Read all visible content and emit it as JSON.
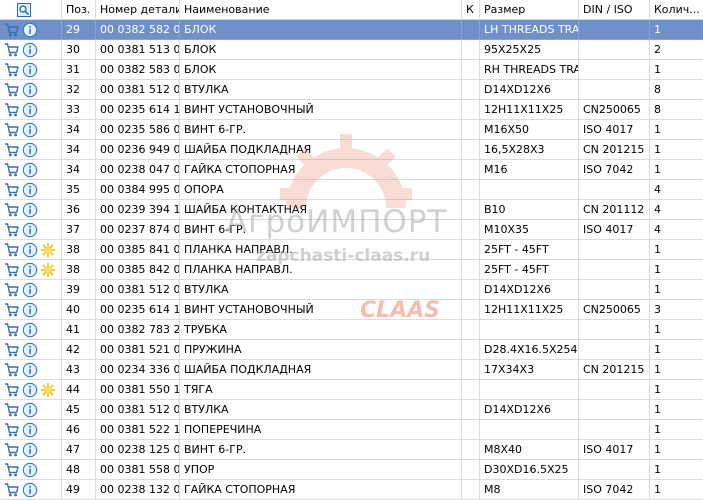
{
  "header": {
    "pos": "Поз.",
    "part_number": "Номер детали",
    "name": "Наименование",
    "k": "К",
    "size": "Размер",
    "din_iso": "DIN / ISO",
    "qty": "Колич..."
  },
  "watermark": {
    "brand_ru": "АгроИМПОРТ",
    "site": "zapchasti-claas.ru",
    "logo": "CLAAS"
  },
  "colors": {
    "cart": "#2f6fb4",
    "info": "#2a7cc7",
    "star": "#f2c200",
    "selected": "#6f90c9",
    "watermark_red": "#e0451f"
  },
  "rows": [
    {
      "pos": "29",
      "part": "00 0382 582 0",
      "name": "БЛОК",
      "size": "LH THREADS TRAP",
      "din": "",
      "qty": "1",
      "star": false,
      "selected": true
    },
    {
      "pos": "30",
      "part": "00 0381 513 0",
      "name": "БЛОК",
      "size": "95X25X25",
      "din": "",
      "qty": "2",
      "star": false,
      "selected": false
    },
    {
      "pos": "31",
      "part": "00 0382 583 0",
      "name": "БЛОК",
      "size": "RH THREADS TRAP",
      "din": "",
      "qty": "1",
      "star": false,
      "selected": false
    },
    {
      "pos": "32",
      "part": "00 0381 512 0",
      "name": "ВТУЛКА",
      "size": "D14XD12X6",
      "din": "",
      "qty": "8",
      "star": false,
      "selected": false
    },
    {
      "pos": "33",
      "part": "00 0235 614 1",
      "name": "ВИНТ УСТАНОВОЧНЫЙ",
      "size": "12H11X11X25",
      "din": "CN250065",
      "qty": "8",
      "star": false,
      "selected": false
    },
    {
      "pos": "34",
      "part": "00 0235 586 0",
      "name": "ВИНТ 6-ГР.",
      "size": "M16X50",
      "din": "ISO 4017",
      "qty": "1",
      "star": false,
      "selected": false
    },
    {
      "pos": "34",
      "part": "00 0236 949 0",
      "name": "ШАЙБА ПОДКЛАДНАЯ",
      "size": "16,5X28X3",
      "din": "CN 201215",
      "qty": "1",
      "star": false,
      "selected": false
    },
    {
      "pos": "34",
      "part": "00 0238 047 0",
      "name": "ГАЙКА СТОПОРНАЯ",
      "size": "M16",
      "din": "ISO 7042",
      "qty": "1",
      "star": false,
      "selected": false
    },
    {
      "pos": "35",
      "part": "00 0384 995 0",
      "name": "ОПОРА",
      "size": "",
      "din": "",
      "qty": "4",
      "star": false,
      "selected": false
    },
    {
      "pos": "36",
      "part": "00 0239 394 1",
      "name": "ШАЙБА КОНТАКТНАЯ",
      "size": "B10",
      "din": "CN 201112",
      "qty": "4",
      "star": false,
      "selected": false
    },
    {
      "pos": "37",
      "part": "00 0237 874 0",
      "name": "ВИНТ 6-ГР.",
      "size": "M10X35",
      "din": "ISO 4017",
      "qty": "4",
      "star": false,
      "selected": false
    },
    {
      "pos": "38",
      "part": "00 0385 841 0",
      "name": "ПЛАНКА НАПРАВЛ.",
      "size": "25FT - 45FT",
      "din": "",
      "qty": "1",
      "star": true,
      "selected": false
    },
    {
      "pos": "38",
      "part": "00 0385 842 0",
      "name": "ПЛАНКА НАПРАВЛ.",
      "size": "25FT - 45FT",
      "din": "",
      "qty": "1",
      "star": true,
      "selected": false
    },
    {
      "pos": "39",
      "part": "00 0381 512 0",
      "name": "ВТУЛКА",
      "size": "D14XD12X6",
      "din": "",
      "qty": "1",
      "star": false,
      "selected": false
    },
    {
      "pos": "40",
      "part": "00 0235 614 1",
      "name": "ВИНТ УСТАНОВОЧНЫЙ",
      "size": "12H11X11X25",
      "din": "CN250065",
      "qty": "3",
      "star": false,
      "selected": false
    },
    {
      "pos": "41",
      "part": "00 0382 783 2",
      "name": "ТРУБКА",
      "size": "",
      "din": "",
      "qty": "1",
      "star": false,
      "selected": false
    },
    {
      "pos": "42",
      "part": "00 0381 521 0",
      "name": "ПРУЖИНА",
      "size": "D28.4X16.5X254",
      "din": "",
      "qty": "1",
      "star": false,
      "selected": false
    },
    {
      "pos": "43",
      "part": "00 0234 336 0",
      "name": "ШАЙБА ПОДКЛАДНАЯ",
      "size": "17X34X3",
      "din": "CN 201215",
      "qty": "1",
      "star": false,
      "selected": false
    },
    {
      "pos": "44",
      "part": "00 0381 550 1",
      "name": "ТЯГА",
      "size": "",
      "din": "",
      "qty": "1",
      "star": true,
      "selected": false
    },
    {
      "pos": "45",
      "part": "00 0381 512 0",
      "name": "ВТУЛКА",
      "size": "D14XD12X6",
      "din": "",
      "qty": "1",
      "star": false,
      "selected": false
    },
    {
      "pos": "46",
      "part": "00 0381 522 1",
      "name": "ПОПЕРЕЧИНА",
      "size": "",
      "din": "",
      "qty": "1",
      "star": false,
      "selected": false
    },
    {
      "pos": "47",
      "part": "00 0238 125 0",
      "name": "ВИНТ 6-ГР.",
      "size": "M8X40",
      "din": "ISO 4017",
      "qty": "1",
      "star": false,
      "selected": false
    },
    {
      "pos": "48",
      "part": "00 0381 558 0",
      "name": "УПОР",
      "size": "D30XD16.5X25",
      "din": "",
      "qty": "1",
      "star": false,
      "selected": false
    },
    {
      "pos": "49",
      "part": "00 0238 132 0",
      "name": "ГАЙКА СТОПОРНАЯ",
      "size": "M8",
      "din": "ISO 7042",
      "qty": "1",
      "star": false,
      "selected": false
    }
  ]
}
